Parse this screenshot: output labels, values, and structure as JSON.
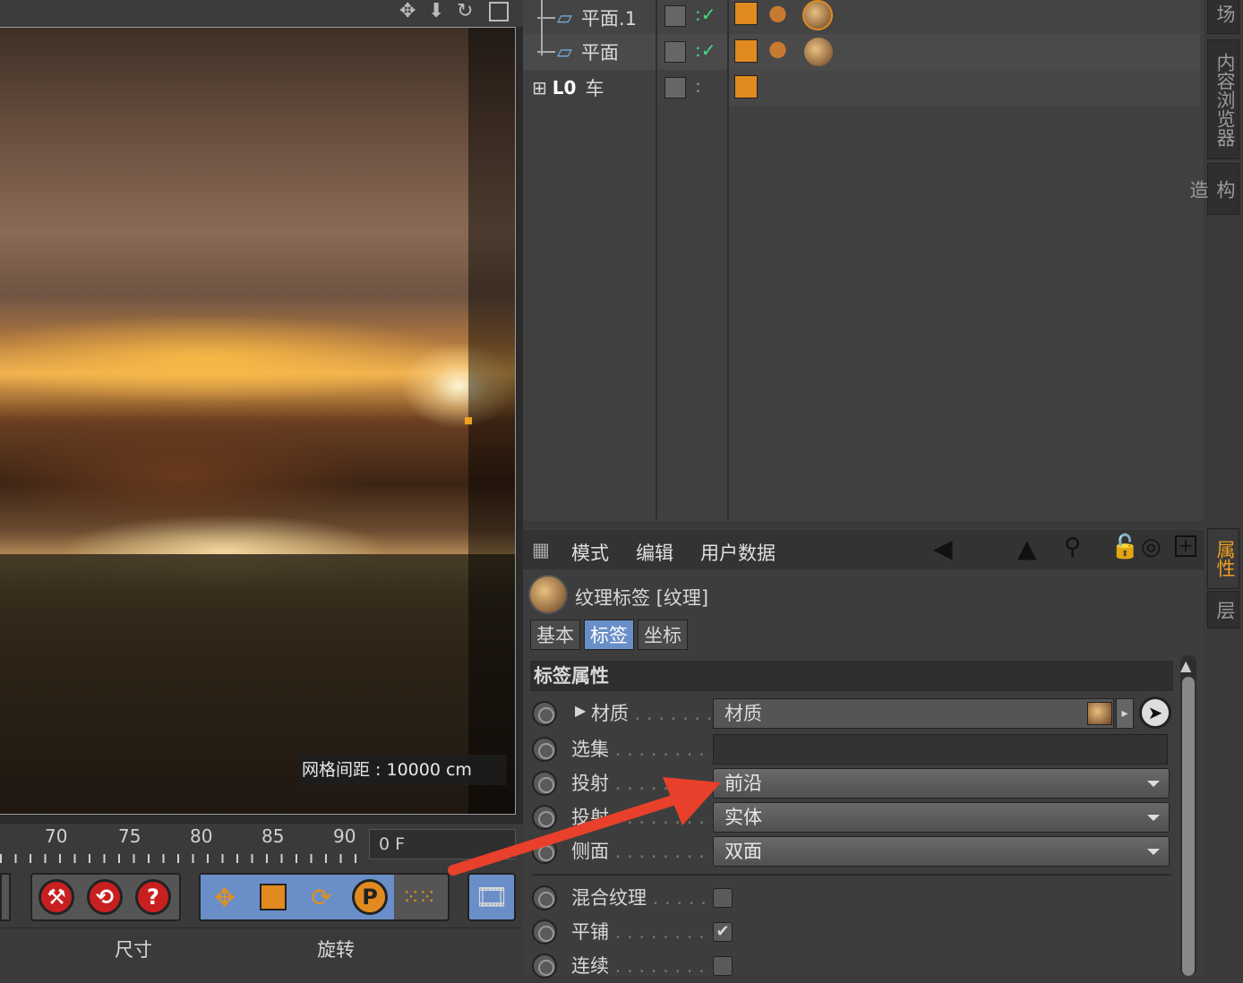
{
  "viewport": {
    "header_icons": [
      "move-icon",
      "down-arrow-icon",
      "rotate-icon",
      "maximize-icon"
    ],
    "grid_info": "网格间距 : 10000 cm"
  },
  "timeline": {
    "ticks": [
      "70",
      "75",
      "80",
      "85",
      "90"
    ],
    "frame": "0 F"
  },
  "toolbar": {
    "left_buttons": [
      "wrench-icon",
      "loop-icon",
      "help-icon"
    ],
    "right_buttons": [
      "move-icon",
      "scale-icon",
      "rotate-icon",
      "p-icon",
      "dots-icon"
    ],
    "film_button": "film-icon"
  },
  "coord_header": {
    "size": "尺寸",
    "rotation": "旋转"
  },
  "object_manager": {
    "objects": [
      {
        "name": "平面.1",
        "icon": "plane-icon"
      },
      {
        "name": "平面",
        "icon": "plane-icon"
      },
      {
        "name": "车",
        "icon": "null-icon"
      }
    ]
  },
  "attribute_manager": {
    "menu": [
      "模式",
      "编辑",
      "用户数据"
    ],
    "title": "纹理标签 [纹理]",
    "tabs": [
      "基本",
      "标签",
      "坐标"
    ],
    "active_tab": "标签",
    "section": "标签属性",
    "properties": [
      {
        "label": "材质",
        "value": "材质",
        "kind": "link"
      },
      {
        "label": "选集",
        "value": "",
        "kind": "field"
      },
      {
        "label": "投射",
        "value": "前沿",
        "kind": "dropdown"
      },
      {
        "label": "投射",
        "value": "实体",
        "kind": "dropdown"
      },
      {
        "label": "侧面",
        "value": "双面",
        "kind": "dropdown"
      },
      {
        "label": "混合纹理",
        "value": false,
        "kind": "checkbox"
      },
      {
        "label": "平铺",
        "value": true,
        "kind": "checkbox"
      },
      {
        "label": "连续",
        "value": false,
        "kind": "checkbox"
      }
    ]
  },
  "dock_tabs": {
    "top_cut": "场次",
    "content_browser": "内容浏览器",
    "construct": "构造",
    "attributes": "属性",
    "layers": "层"
  },
  "colors": {
    "accent_blue": "#6a8fc8",
    "active_tab_orange": "#f0a020",
    "annotation_arrow": "#e8402a"
  }
}
